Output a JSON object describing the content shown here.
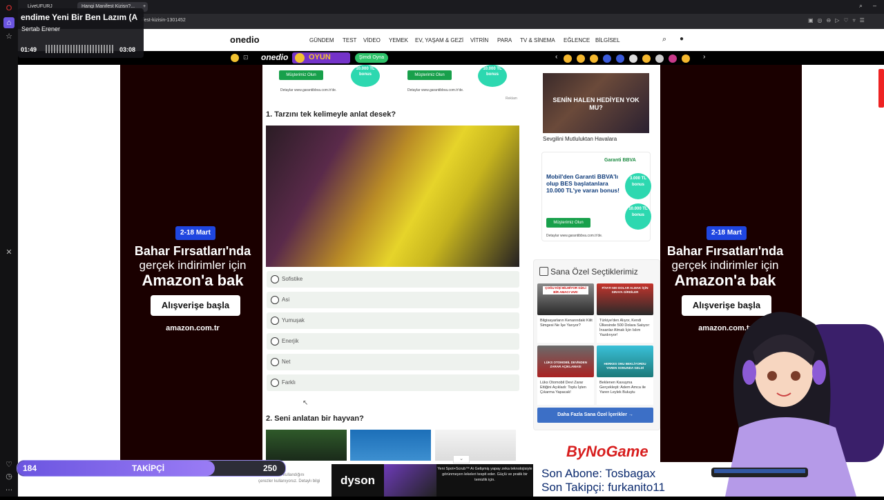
{
  "browser": {
    "tabs": [
      "LiveUFURJ",
      "Hangi Manifest Kizisn?..."
    ],
    "url_fragment": "ifest-kizisin-1301452"
  },
  "music": {
    "title": "endime Yeni Bir Ben Lazım (A",
    "artist": "Sertab Erener",
    "elapsed": "01:49",
    "duration": "03:08",
    "progress": 0.58
  },
  "site": {
    "logo": "onedio",
    "nav": [
      "GÜNDEM",
      "TEST",
      "VİDEO",
      "YEMEK",
      "EV, YAŞAM & GEZİ",
      "VİTRİN",
      "PARA",
      "TV & SİNEMA",
      "EĞLENCE",
      "BİLGİSEL"
    ],
    "strip_logo": "onedio",
    "strip_game": "OYUN",
    "strip_cta": "Şimdi Oyna"
  },
  "side_ad": {
    "date": "2-18 Mart",
    "line1": "Bahar Fırsatları'nda",
    "line2": "gerçek indirimler için",
    "line3": "Amazon'a bak",
    "button": "Alışverişe başla",
    "brand": "amazon.com.tr"
  },
  "top_ads": {
    "button": "Müşterimiz Olun",
    "bubble": "10.000 TL bonus",
    "fineprint": "Detaylar www.garantibbva.com.tr'de.",
    "tag": "Reklam"
  },
  "quiz": {
    "q1": "1. Tarzını tek kelimeyle anlat desek?",
    "options": [
      "Sofistike",
      "Asi",
      "Yumuşak",
      "Enerjik",
      "Net",
      "Farklı"
    ],
    "q2": "2. Seni anlatan bir hayvan?"
  },
  "right": {
    "promo_caption": "SENİN HALEN HEDİYEN YOK MU?",
    "promo_title": "Sevgilini Mutluluktan Havalara",
    "bank_logo": "Garanti BBVA",
    "bank_text": "Mobil'den Garanti BBVA'lı olup BES başlatanlara 10.000 TL'ye varan bonus!",
    "bank_button": "Müşterimiz Olun",
    "bank_bubble1": "3.000 TL bonus",
    "bank_bubble2": "10.000 TL bonus",
    "bank_fine": "Detaylar www.garantibbva.com.tr'de.",
    "picks_title": "Sana Özel Seçtiklerimiz",
    "picks": [
      {
        "overlay": "ÇOĞU KİŞİ BİLMİYOR GİZLİ BİR AMACI VAR!",
        "text": "Bilgisayarların Kenarındaki Kilit Simgesi Ne İşe Yarıyor?"
      },
      {
        "overlay": "FİYATI 500 DOLAR ALMAK İÇİN SIRAYA GİRDİLER",
        "text": "Türkiye'den Alıyor, Kendi Ülkesinde 500 Dolara Satıyor: İnsanlar Almak İçin Islım Yazdırıyor!"
      },
      {
        "overlay": "LÜKS OTOMOBİL DEVİNDEN ZARAR AÇIKLAMASI",
        "text": "Lüks Otomobil Devi Zarar Ettiğini Açıkladı: Toplu İşten Çıkarma Yapacak!"
      },
      {
        "overlay": "HERKES ONU BEKLİYORDU YAREN SONUNDA GELDİ",
        "text": "Beklenen Kavuşma Gerçekleşti: Adem Amca ile Yaren Leylek Buluştu"
      }
    ],
    "more": "Daha Fazla Sana Özel İçerikler →",
    "bottom_logo": "ByNoGame"
  },
  "followers": {
    "current": "184",
    "label": "TAKİPÇİ",
    "goal": "250",
    "fill": 0.736
  },
  "banner": {
    "brand": "dyson",
    "ad_text": "Yeni Spot+Scrub™ Ai Gelişmiş yapay zeka teknolojisiyle görünmeyen lekeleri tespit eder. Güçlü ve pratik bir temizlik için.",
    "sub": "Son Abone: Tosbagax",
    "follow": "Son Takipçi: furkanito11"
  },
  "footer_text": "çerezler kullanıyoruz. Detaylı bilgi",
  "footer_text2": "sitemizi nasıl kullandığını",
  "colors": {
    "accent_purple": "#7b63ea",
    "amazon_blue": "#1f46e0",
    "garanti_green": "#18a04b",
    "teal": "#2dd8b0",
    "more_btn": "#3c6fc6"
  }
}
